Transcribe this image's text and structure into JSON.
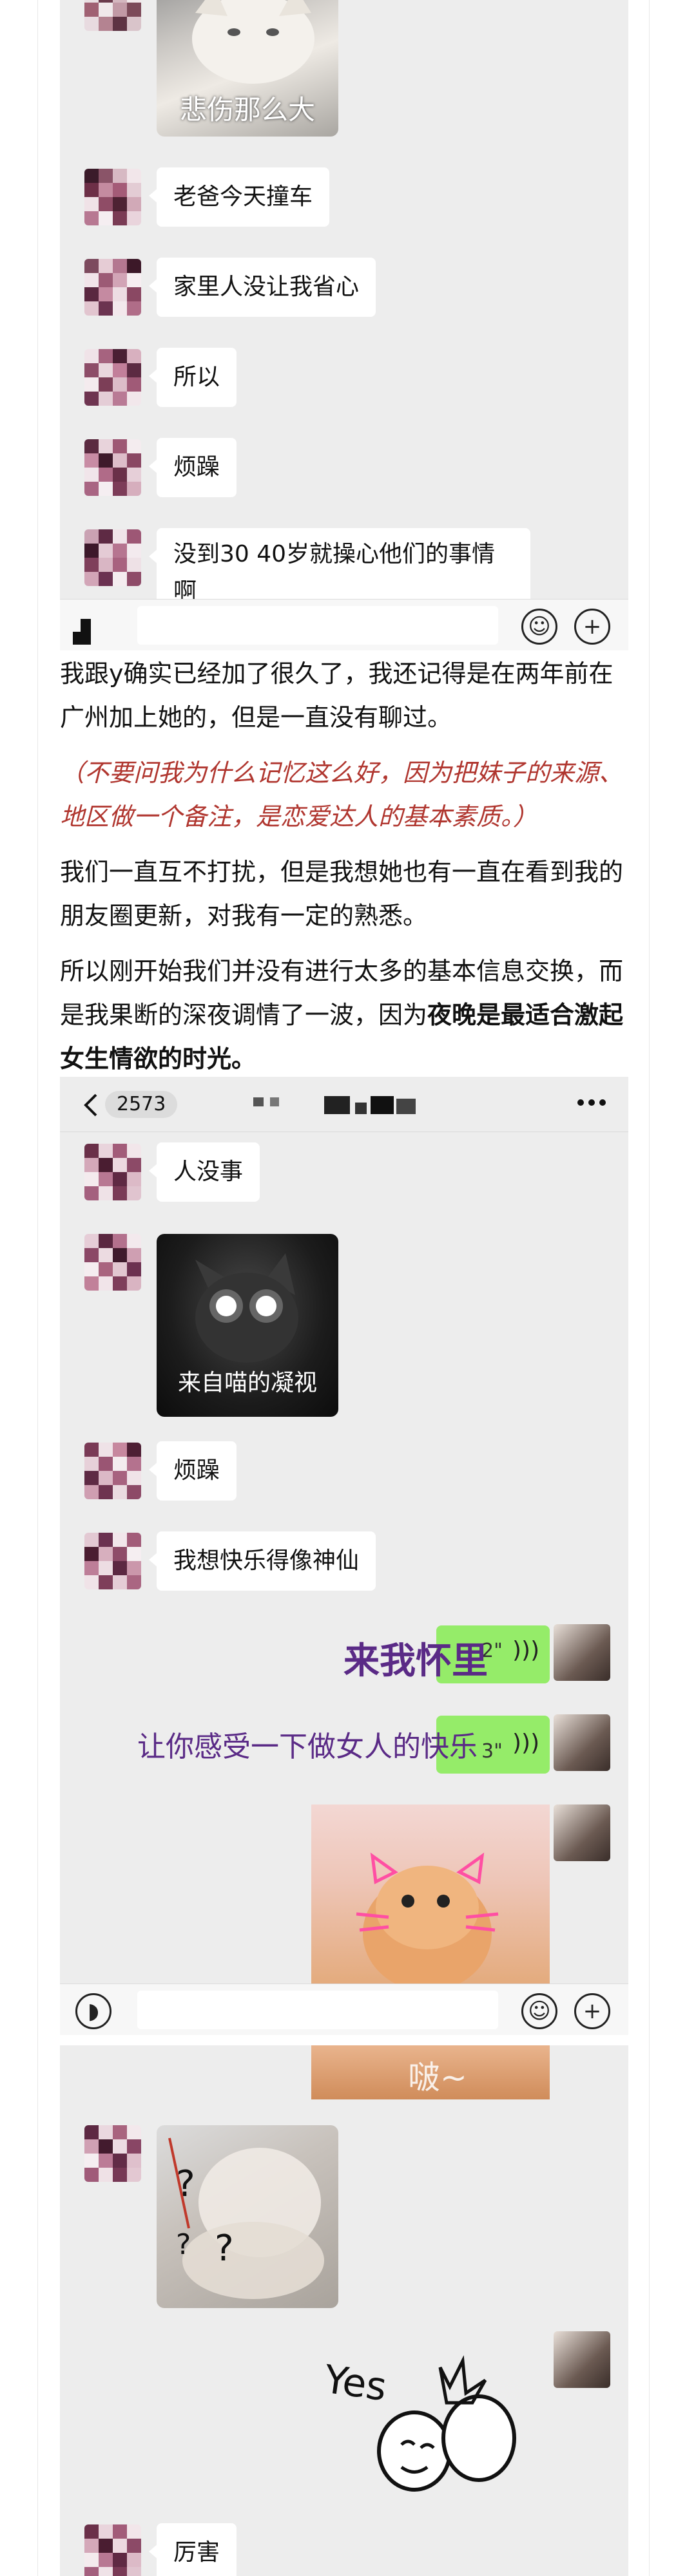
{
  "screenshot1": {
    "sticker_caption": "悲伤那么大",
    "messages": [
      "老爸今天撞车",
      "家里人没让我省心",
      "所以",
      "烦躁",
      "没到30 40岁就操心他们的事情",
      "啊"
    ]
  },
  "article": {
    "para1": "我跟y确实已经加了很久了，我还记得是在两年前在广州加上她的，但是一直没有聊过。",
    "para2": "（不要问我为什么记忆这么好，因为把妹子的来源、地区做一个备注，是恋爱达人的基本素质。）",
    "para3": "我们一直互不打扰，但是我想她也有一直在看到我的朋友圈更新，对我有一定的熟悉。",
    "para4_normal": "所以刚开始我们并没有进行太多的基本信息交换，而是我果断的深夜调情了一波，因为",
    "para4_bold": "夜晚是最适合激起女生情欲的时光。"
  },
  "screenshot2": {
    "unread_count": "2573",
    "messages_left": [
      "人没事",
      "烦躁",
      "我想快乐得像神仙"
    ],
    "sticker_caption": "来自喵的凝视",
    "overlay_text_1": "来我怀里",
    "overlay_text_2": "让你感受一下做女人的快乐",
    "voice_seconds_1": "2\"",
    "voice_seconds_2": "3\""
  },
  "screenshot3": {
    "top_sticker_text": "啵~",
    "yes_sticker_text": "Yes",
    "last_message": "厉害"
  },
  "colors": {
    "chat_bg": "#ededed",
    "green_bubble": "#95ec69",
    "quote_red": "#b0362f",
    "overlay_purple": "#5a2a86"
  }
}
